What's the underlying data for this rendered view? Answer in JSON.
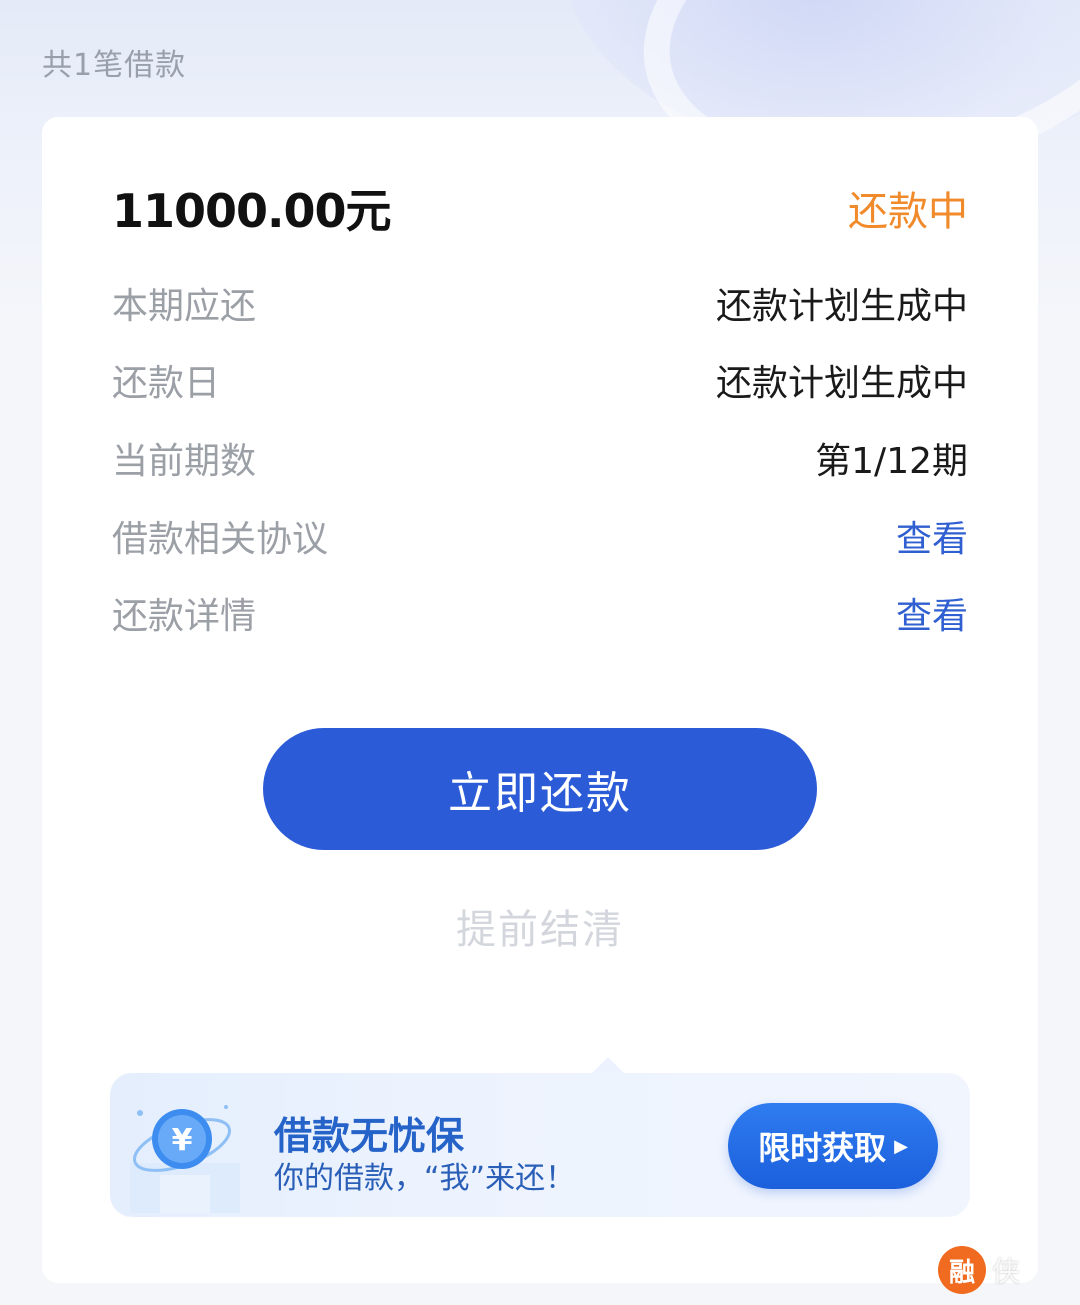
{
  "header": {
    "loan_count_text": "共1笔借款"
  },
  "loan_card": {
    "amount": "11000.00元",
    "status": "还款中",
    "rows": [
      {
        "label": "本期应还",
        "value": "还款计划生成中"
      },
      {
        "label": "还款日",
        "value": "还款计划生成中"
      },
      {
        "label": "当前期数",
        "value": "第1/12期"
      },
      {
        "label": "借款相关协议",
        "value": "查看"
      },
      {
        "label": "还款详情",
        "value": "查看"
      }
    ],
    "repay_now_label": "立即还款",
    "early_settle_label": "提前结清"
  },
  "promo": {
    "icon": "yen-coin-icon",
    "title": "借款无忧保",
    "subtitle": "你的借款，“我”来还！",
    "button_label": "限时获取"
  },
  "watermark": {
    "logo_char": "融",
    "text": "侠"
  },
  "colors": {
    "status_orange": "#f08a2a",
    "link_blue": "#2f5fd0",
    "primary_button": "#2c5bd8"
  }
}
